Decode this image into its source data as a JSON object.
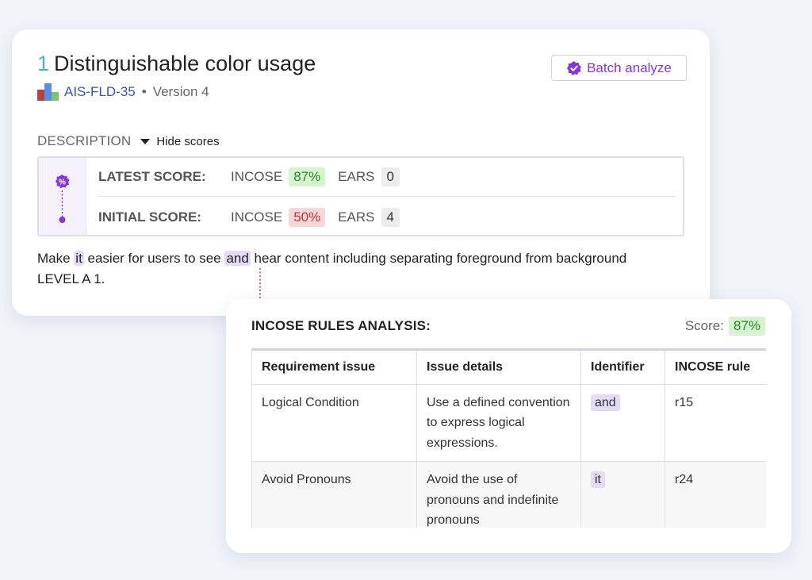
{
  "requirement": {
    "number": "1",
    "title": "Distinguishable color usage",
    "id": "AIS-FLD-35",
    "version": "Version 4"
  },
  "actions": {
    "batch_analyze": "Batch analyze"
  },
  "description": {
    "label": "DESCRIPTION",
    "toggle": "Hide scores",
    "text_parts": [
      "Make ",
      "it",
      " easier for users to see ",
      "and",
      " hear content including separating foreground from background LEVEL A 1."
    ]
  },
  "scores": {
    "latest": {
      "label": "LATEST SCORE:",
      "incose_label": "INCOSE",
      "incose_value": "87%",
      "ears_label": "EARS",
      "ears_value": "0"
    },
    "initial": {
      "label": "INITIAL SCORE:",
      "incose_label": "INCOSE",
      "incose_value": "50%",
      "ears_label": "EARS",
      "ears_value": "4"
    }
  },
  "analysis": {
    "title": "INCOSE RULES ANALYSIS:",
    "score_label": "Score:",
    "score_value": "87%",
    "columns": [
      "Requirement issue",
      "Issue details",
      "Identifier",
      "INCOSE rule"
    ],
    "rows": [
      [
        "Logical Condition",
        "Use a defined convention to express logical expressions.",
        "and",
        "r15"
      ],
      [
        "Avoid Pronouns",
        "Avoid the use of pronouns and indefinite pronouns",
        "it",
        "r24"
      ]
    ]
  },
  "colors": {
    "accent": "#8a35d6",
    "link": "#3d55b5",
    "good": "#2a8b2a",
    "bad": "#c23838",
    "highlight": "#e5dbf7"
  },
  "icons": [
    "project-bars-icon",
    "verified-badge-icon",
    "caret-down-icon",
    "percent-badge-icon"
  ]
}
